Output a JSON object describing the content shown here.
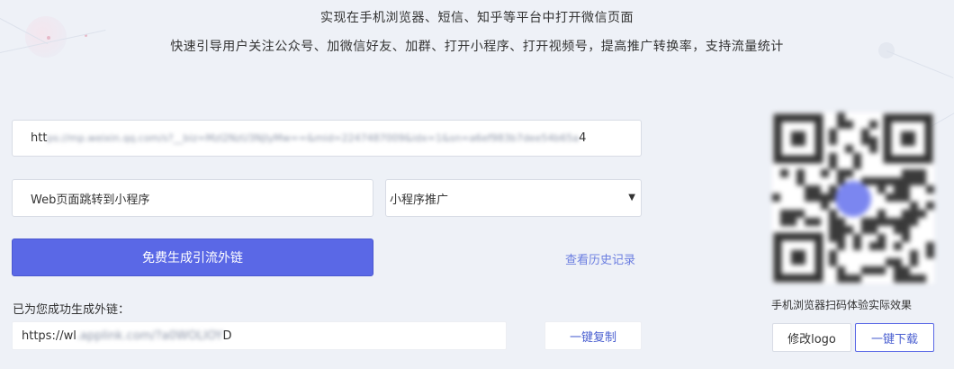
{
  "header": {
    "line1": "实现在手机浏览器、短信、知乎等平台中打开微信页面",
    "line2": "快速引导用户关注公众号、加微信好友、加群、打开小程序、打开视频号，提高推广转换率，支持流量统计"
  },
  "form": {
    "url_visible": "htt",
    "url_obscured": "ps://mp.weixin.qq.com/s?__biz=MzI2NzU3NjIyMw==&mid=2247487009&idx=1&sn=a6ef983b7dee54b65a",
    "url_tail": "4",
    "title_value": "Web页面跳转到小程序",
    "type_selected": "小程序推广",
    "type_caret": "▼"
  },
  "actions": {
    "generate_label": "免费生成引流外链",
    "history_label": "查看历史记录"
  },
  "result": {
    "success_label": "已为您成功生成外链：",
    "link_visible": "https://wl",
    "link_obscured": ".applink.com/?a0WOLIOY",
    "link_tail": "D",
    "copy_label": "一键复制"
  },
  "qr": {
    "caption": "手机浏览器扫码体验实际效果",
    "modify_logo_label": "修改logo",
    "download_label": "一键下载",
    "center_color": "#7b86f0"
  },
  "colors": {
    "accent": "#5a68e6",
    "link": "#6b7ee0",
    "background": "#eef1f7"
  }
}
